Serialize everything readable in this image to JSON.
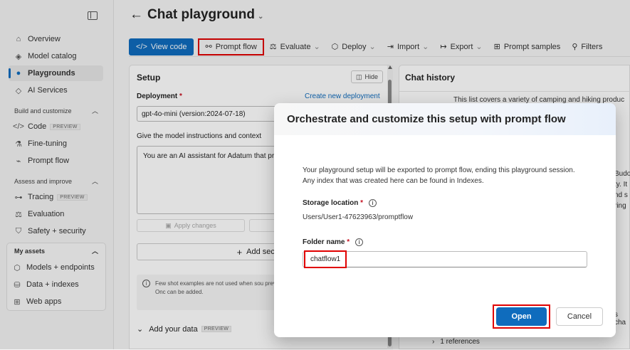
{
  "sidebar": {
    "top": [
      {
        "label": "Overview",
        "icon": "home-icon"
      },
      {
        "label": "Model catalog",
        "icon": "catalog-icon"
      },
      {
        "label": "Playgrounds",
        "icon": "chat-icon",
        "active": true
      },
      {
        "label": "AI Services",
        "icon": "services-icon"
      }
    ],
    "build_header": "Build and customize",
    "build": [
      {
        "label": "Code",
        "icon": "code-icon",
        "badge": "PREVIEW"
      },
      {
        "label": "Fine-tuning",
        "icon": "flask-icon"
      },
      {
        "label": "Prompt flow",
        "icon": "flow-icon"
      }
    ],
    "assess_header": "Assess and improve",
    "assess": [
      {
        "label": "Tracing",
        "icon": "tracing-icon",
        "badge": "PREVIEW"
      },
      {
        "label": "Evaluation",
        "icon": "scale-icon"
      },
      {
        "label": "Safety + security",
        "icon": "shield-icon"
      }
    ],
    "assets_header": "My assets",
    "assets": [
      {
        "label": "Models + endpoints",
        "icon": "cube-icon"
      },
      {
        "label": "Data + indexes",
        "icon": "database-icon"
      },
      {
        "label": "Web apps",
        "icon": "grid-icon"
      }
    ]
  },
  "page": {
    "title": "Chat playground"
  },
  "toolbar": {
    "view_code": "View code",
    "prompt_flow": "Prompt flow",
    "evaluate": "Evaluate",
    "deploy": "Deploy",
    "import": "Import",
    "export": "Export",
    "prompt_samples": "Prompt samples",
    "filters": "Filters"
  },
  "setup": {
    "title": "Setup",
    "hide": "Hide",
    "deployment_label": "Deployment",
    "create_new": "Create new deployment",
    "deployment_value": "gpt-4o-mini (version:2024-07-18)",
    "instructions_label": "Give the model instructions and context",
    "instructions_value": "You are an AI assistant for Adatum that products.",
    "apply": "Apply changes",
    "add_section": "Add secti",
    "few_shot_note": "Few shot examples are not used when sou previous examples have been cleared. Onc can be added.",
    "add_data": "Add your data",
    "add_data_badge": "PREVIEW"
  },
  "chat": {
    "title": "Chat history",
    "snippet": "This list covers a variety of camping and hiking produc",
    "side_frag1": "Budo",
    "side_frag2": "ty. It",
    "side_frag3": "nd s",
    "side_frag4": "ring",
    "side_frag5": "s cha",
    "references": "1 references"
  },
  "dialog": {
    "title": "Orchestrate and customize this setup with prompt flow",
    "message": "Your playground setup will be exported to prompt flow, ending this playground session. Any index that was created here can be found in Indexes.",
    "storage_label": "Storage location",
    "storage_value": "Users/User1-47623963/promptflow",
    "folder_label": "Folder name",
    "folder_value": "chatflow1",
    "open": "Open",
    "cancel": "Cancel"
  },
  "colors": {
    "accent": "#0f6cbd",
    "highlight": "#e00000"
  }
}
